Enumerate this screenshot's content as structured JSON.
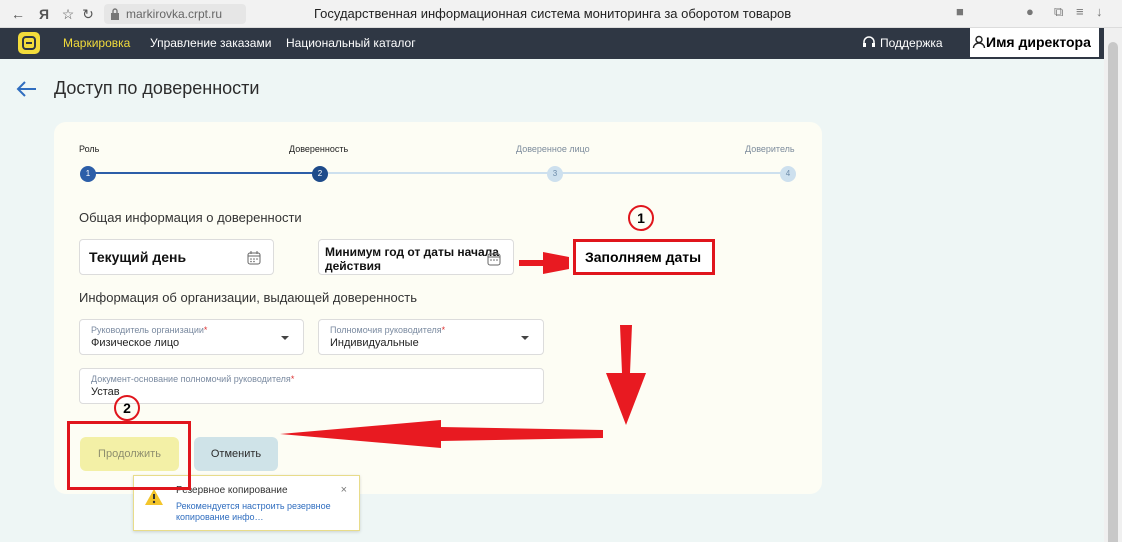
{
  "browser": {
    "address": "markirovka.crpt.ru",
    "tab_title": "Государственная информационная система мониторинга за оборотом товаров"
  },
  "nav": {
    "items": [
      "Маркировка",
      "Управление заказами",
      "Национальный каталог"
    ],
    "support": "Поддержка",
    "user": "Имя директора"
  },
  "page": {
    "title": "Доступ по доверенности"
  },
  "stepper": {
    "steps": [
      {
        "label": "Роль",
        "num": "1"
      },
      {
        "label": "Доверенность",
        "num": "2"
      },
      {
        "label": "Доверенное лицо",
        "num": "3"
      },
      {
        "label": "Доверитель",
        "num": "4"
      }
    ]
  },
  "general": {
    "title": "Общая информация о доверенности",
    "date_from": "Текущий день",
    "date_to": "Минимум год от даты начала действия"
  },
  "org": {
    "title": "Информация об организации, выдающей доверенность",
    "head": {
      "label": "Руководитель организации",
      "value": "Физическое лицо"
    },
    "powers": {
      "label": "Полномочия руководителя",
      "value": "Индивидуальные"
    },
    "basis": {
      "label": "Документ-основание полномочий руководителя",
      "value": "Устав"
    }
  },
  "buttons": {
    "continue": "Продолжить",
    "cancel": "Отменить"
  },
  "annotations": {
    "note": "Заполняем даты",
    "circle1": "1",
    "circle2": "2",
    "color": "#e0151c"
  },
  "toast": {
    "title": "Резервное копирование",
    "body": "Рекомендуется настроить резервное копирование инфо…",
    "close": "×"
  }
}
